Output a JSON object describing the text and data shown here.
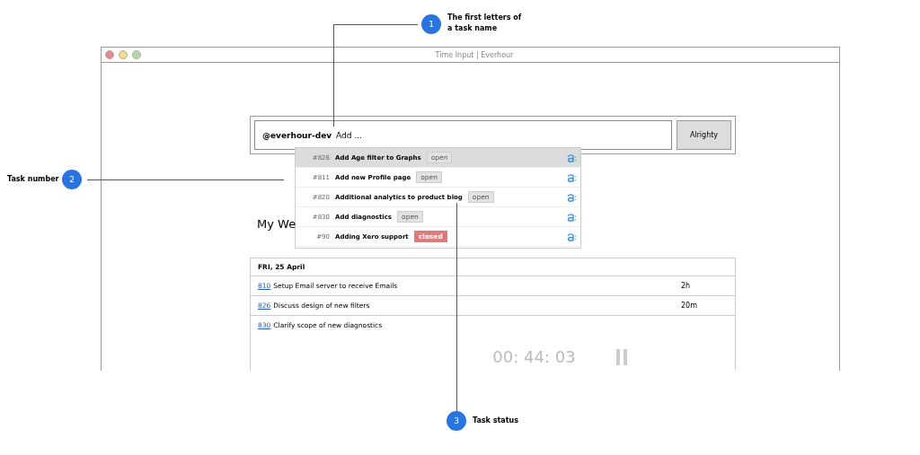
{
  "window": {
    "title": "Time Input | Everhour"
  },
  "task_input": {
    "workspace": "@everhour-dev",
    "value": "Add ...",
    "button": "Alrighty"
  },
  "suggestions": [
    {
      "number": "#826",
      "name": "Add Age filter to Graphs",
      "status": "open",
      "kind": "open",
      "selected": true
    },
    {
      "number": "#811",
      "name": "Add new Profile page",
      "status": "open",
      "kind": "open",
      "selected": false
    },
    {
      "number": "#820",
      "name": "Additional analytics to product blog",
      "status": "open",
      "kind": "open",
      "selected": false
    },
    {
      "number": "#830",
      "name": "Add diagnostics",
      "status": "open",
      "kind": "open",
      "selected": false
    },
    {
      "number": "#90",
      "name": "Adding Xero support",
      "status": "closed",
      "kind": "closed",
      "selected": false
    }
  ],
  "heading": "My We",
  "day": {
    "label": "FRI, 25 April",
    "entries": [
      {
        "number": "810",
        "title": "Setup Email server to receive Emails",
        "duration": "2h"
      },
      {
        "number": "826",
        "title": "Discuss design of new filters",
        "duration": "20m"
      },
      {
        "number": "830",
        "title": "Clarify scope of new diagnostics"
      }
    ]
  },
  "timer": "00: 44: 03",
  "callouts": [
    {
      "number": "1",
      "text": "The first letters of\na task name"
    },
    {
      "number": "2",
      "text": "Task number"
    },
    {
      "number": "3",
      "text": "Task status"
    }
  ]
}
